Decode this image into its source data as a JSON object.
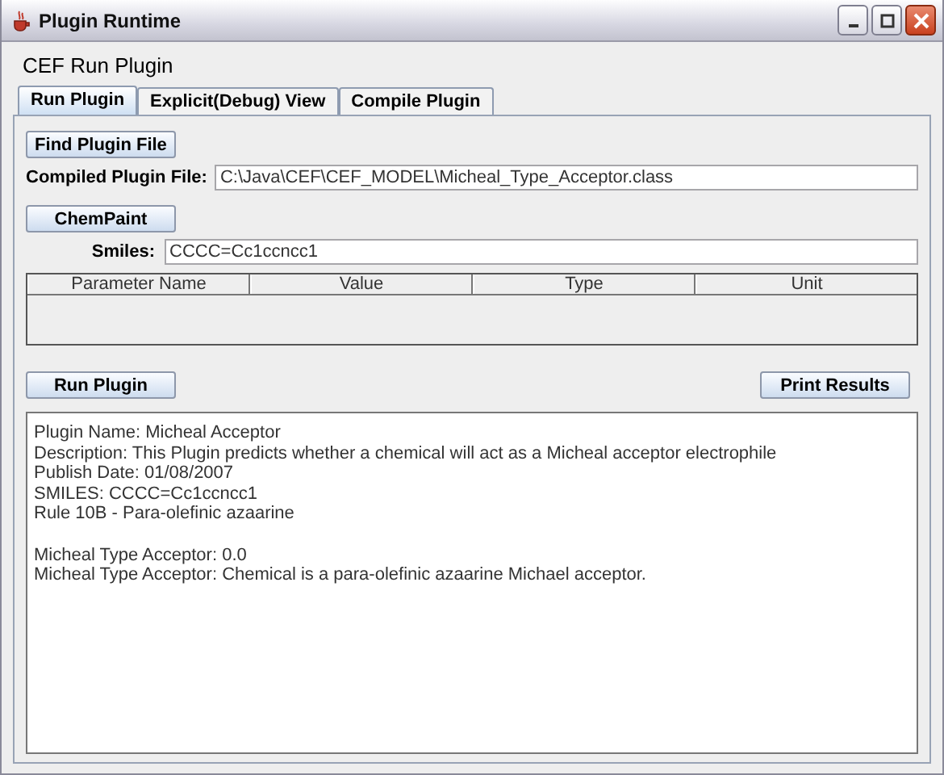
{
  "window": {
    "title": "Plugin Runtime"
  },
  "heading": "CEF Run Plugin",
  "tabs": [
    {
      "label": "Run Plugin",
      "selected": true
    },
    {
      "label": "Explicit(Debug) View",
      "selected": false
    },
    {
      "label": "Compile Plugin",
      "selected": false
    }
  ],
  "find_button": "Find Plugin File",
  "plugin_file": {
    "label": "Compiled Plugin File:",
    "value": "C:\\Java\\CEF\\CEF_MODEL\\Micheal_Type_Acceptor.class"
  },
  "chempaint_button": "ChemPaint",
  "smiles": {
    "label": "Smiles:",
    "value": "CCCC=Cc1ccncc1"
  },
  "table": {
    "columns": [
      "Parameter Name",
      "Value",
      "Type",
      "Unit"
    ]
  },
  "run_button": "Run Plugin",
  "print_button": "Print Results",
  "output": [
    {
      "lines": [
        "Plugin Name: Micheal Acceptor",
        "Description: This Plugin predicts whether a chemical will act as a Micheal acceptor electrophile",
        "Publish Date: 01/08/2007",
        "SMILES: CCCC=Cc1ccncc1",
        "Rule 10B - Para-olefinic azaarine"
      ]
    },
    {
      "lines": [
        "Micheal Type Acceptor: 0.0",
        "Micheal Type Acceptor: Chemical is a para-olefinic azaarine Michael acceptor."
      ]
    }
  ]
}
